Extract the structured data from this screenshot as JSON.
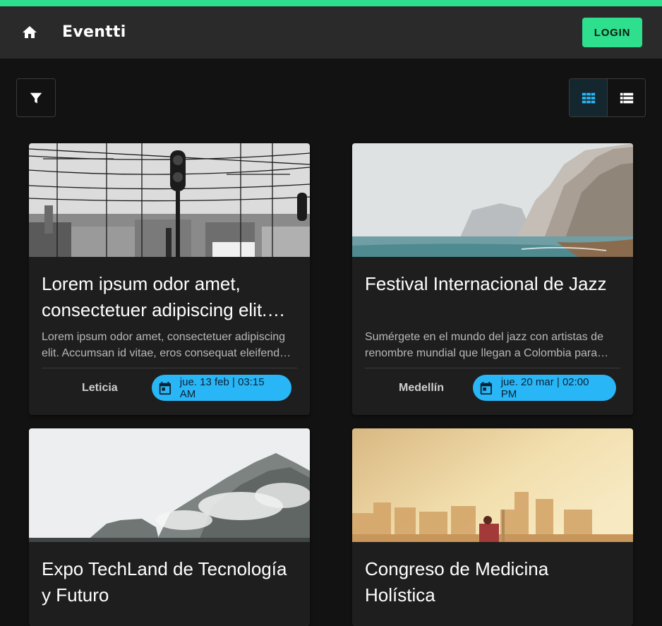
{
  "app": {
    "brand": "Eventti",
    "login_label": "LOGIN",
    "accent_color": "#2ee08d",
    "chip_color": "#29b6f6"
  },
  "toolbar": {
    "filter_icon": "filter-icon",
    "view_options": [
      "grid-view-icon",
      "list-view-icon"
    ],
    "active_view": "grid"
  },
  "events": [
    {
      "title": "Lorem ipsum odor amet, consectetuer adipiscing elit. Accumsan id vitae",
      "description": "Lorem ipsum odor amet, consectetuer adipiscing elit. Accumsan id vitae, eros consequat eleifend semper",
      "city": "Leticia",
      "date": "jue. 13 feb | 03:15 AM",
      "image": "railway-power-lines-photo"
    },
    {
      "title": "Festival Internacional de Jazz",
      "description": "Sumérgete en el mundo del jazz con artistas de renombre mundial que llegan a Colombia para deleitarte",
      "city": "Medellín",
      "date": "jue. 20 mar | 02:00 PM",
      "image": "foggy-coastal-cliffs-photo"
    },
    {
      "title": "Expo TechLand de Tecnología y Futuro",
      "description": "",
      "city": "",
      "date": "",
      "image": "misty-mountain-peaks-photo"
    },
    {
      "title": "Congreso de Medicina Holística",
      "description": "",
      "city": "",
      "date": "",
      "image": "hazy-city-sunrise-photo"
    }
  ]
}
